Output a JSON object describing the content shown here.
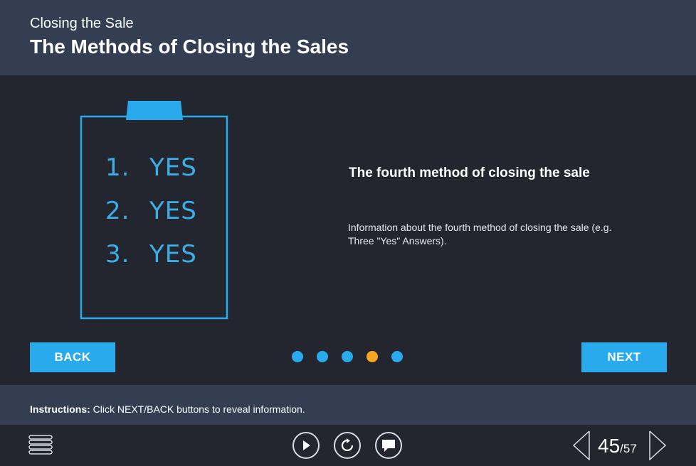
{
  "header": {
    "subtitle": "Closing the Sale",
    "title": "The Methods of Closing the Sales"
  },
  "illustration": {
    "lines": [
      {
        "num": "1.",
        "text": "YES"
      },
      {
        "num": "2.",
        "text": "YES"
      },
      {
        "num": "3.",
        "text": "YES"
      }
    ],
    "icon": "clipboard-icon"
  },
  "content": {
    "heading": "The fourth method of closing the sale",
    "body": "Information about the fourth method of closing the sale (e.g. Three \"Yes\" Answers)."
  },
  "navigation": {
    "back_label": "BACK",
    "next_label": "NEXT",
    "dots_total": 5,
    "active_dot": 4
  },
  "instructions": {
    "label": "Instructions:",
    "text": " Click NEXT/BACK buttons to reveal information."
  },
  "player": {
    "current_page": "45",
    "total_pages": "/57",
    "icons": [
      "menu-icon",
      "play-icon",
      "replay-icon",
      "comment-icon",
      "prev-arrow-icon",
      "next-arrow-icon"
    ]
  },
  "colors": {
    "accent": "#29aaed",
    "active_dot": "#f5a623",
    "header_bg": "#343e52",
    "main_bg": "#23262f"
  }
}
